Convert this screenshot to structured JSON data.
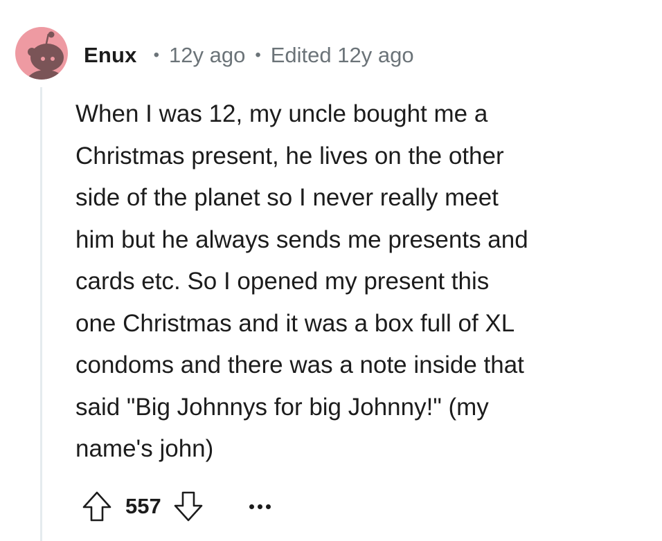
{
  "comment": {
    "username": "Enux",
    "separator": "•",
    "timestamp": "12y ago",
    "edited": "Edited 12y ago",
    "body": "When I was 12, my uncle bought me a\nChristmas present, he lives on the other\nside of the planet so I never really meet\nhim but he always sends me presents and\ncards etc. So I opened my present this\none Christmas and it was a box full of XL\ncondoms and there was a note inside that\nsaid \"Big Johnnys for big Johnny!\" (my\nname's john)",
    "score": "557"
  },
  "icons": {
    "avatar": "snoo-avatar-icon",
    "upvote": "upvote-arrow-icon",
    "downvote": "downvote-arrow-icon",
    "more": "more-options-icon"
  },
  "colors": {
    "avatar_bg": "#ee9aa2",
    "avatar_figure": "#7a5457",
    "text_primary": "#1c1c1c",
    "text_secondary": "#6b7378",
    "thread_line": "#e5ebee"
  }
}
